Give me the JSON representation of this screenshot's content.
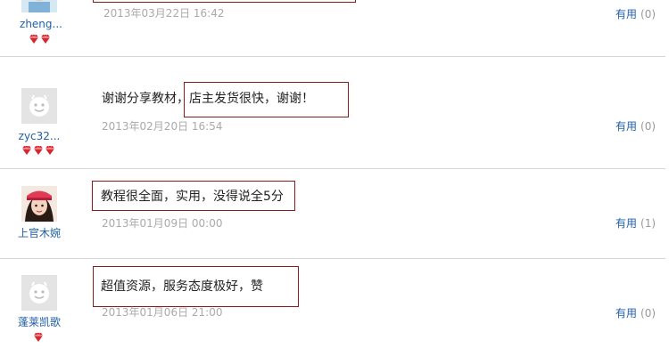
{
  "reviews": [
    {
      "username": "zheng...",
      "gem_count": 2,
      "avatar": "user-photo",
      "content": "",
      "time": "2013年03月22日 16:42",
      "useful_label": "有用",
      "useful_count": "(0)"
    },
    {
      "username": "zyc32...",
      "gem_count": 3,
      "avatar": "default-smiley",
      "content_plain": "谢谢分享教材，",
      "content": "店主发货很快，谢谢！",
      "time": "2013年02月20日 16:54",
      "useful_label": "有用",
      "useful_count": "(0)"
    },
    {
      "username": "上官木婉",
      "gem_count": 0,
      "avatar": "user-photo",
      "content": "教程很全面，实用，没得说全5分",
      "time": "2013年01月09日 00:00",
      "useful_label": "有用",
      "useful_count": "(1)"
    },
    {
      "username": "蓬莱凯歌",
      "gem_count": 1,
      "avatar": "default-smiley",
      "content": "超值资源，服务态度极好，赞",
      "time": "2013年01月06日 21:00",
      "useful_label": "有用",
      "useful_count": "(0)"
    }
  ],
  "colors": {
    "link": "#1f5fa8",
    "timestamp": "#aaaaaa",
    "bubble_border": "#8b1a1a",
    "gem": "#d8262f",
    "separator": "#d6d6d6"
  }
}
